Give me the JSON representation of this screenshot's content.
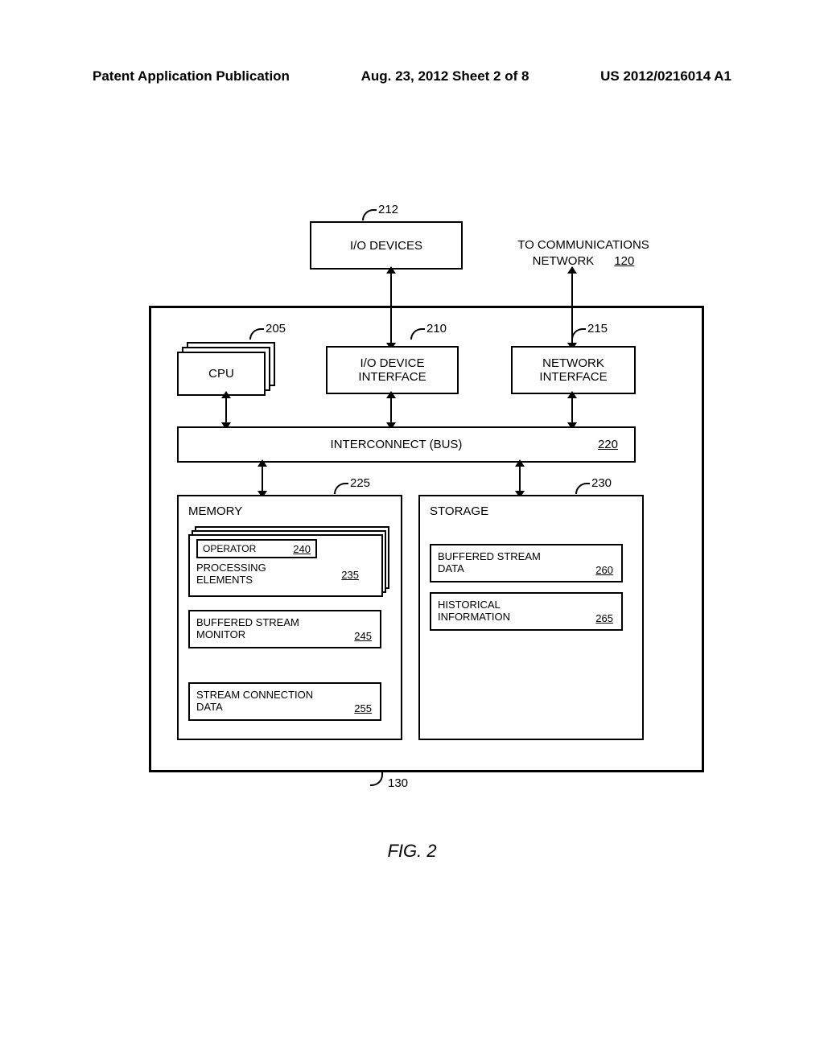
{
  "header": {
    "left": "Patent Application Publication",
    "mid": "Aug. 23, 2012  Sheet 2 of 8",
    "right": "US 2012/0216014 A1"
  },
  "labels": {
    "io_devices": "I/O DEVICES",
    "to_comm_line1": "TO COMMUNICATIONS",
    "to_comm_line2": "NETWORK",
    "cpu": "CPU",
    "io_intf_line1": "I/O DEVICE",
    "io_intf_line2": "INTERFACE",
    "net_intf_line1": "NETWORK",
    "net_intf_line2": "INTERFACE",
    "interconnect": "INTERCONNECT (BUS)",
    "memory": "MEMORY",
    "storage": "STORAGE",
    "operator": "OPERATOR",
    "processing_elements_line1": "PROCESSING",
    "processing_elements_line2": "ELEMENTS",
    "bsm_line1": "BUFFERED STREAM",
    "bsm_line2": "MONITOR",
    "scd_line1": "STREAM CONNECTION",
    "scd_line2": "DATA",
    "bsd_line1": "BUFFERED STREAM",
    "bsd_line2": "DATA",
    "hist_line1": "HISTORICAL",
    "hist_line2": "INFORMATION"
  },
  "refs": {
    "io_devices": "212",
    "to_comm": "120",
    "cpu": "205",
    "io_intf": "210",
    "net_intf": "215",
    "interconnect": "220",
    "memory": "225",
    "storage": "230",
    "pe": "235",
    "operator": "240",
    "bsm": "245",
    "scd": "255",
    "bsd": "260",
    "hist": "265",
    "main": "130"
  },
  "figure": "FIG. 2"
}
